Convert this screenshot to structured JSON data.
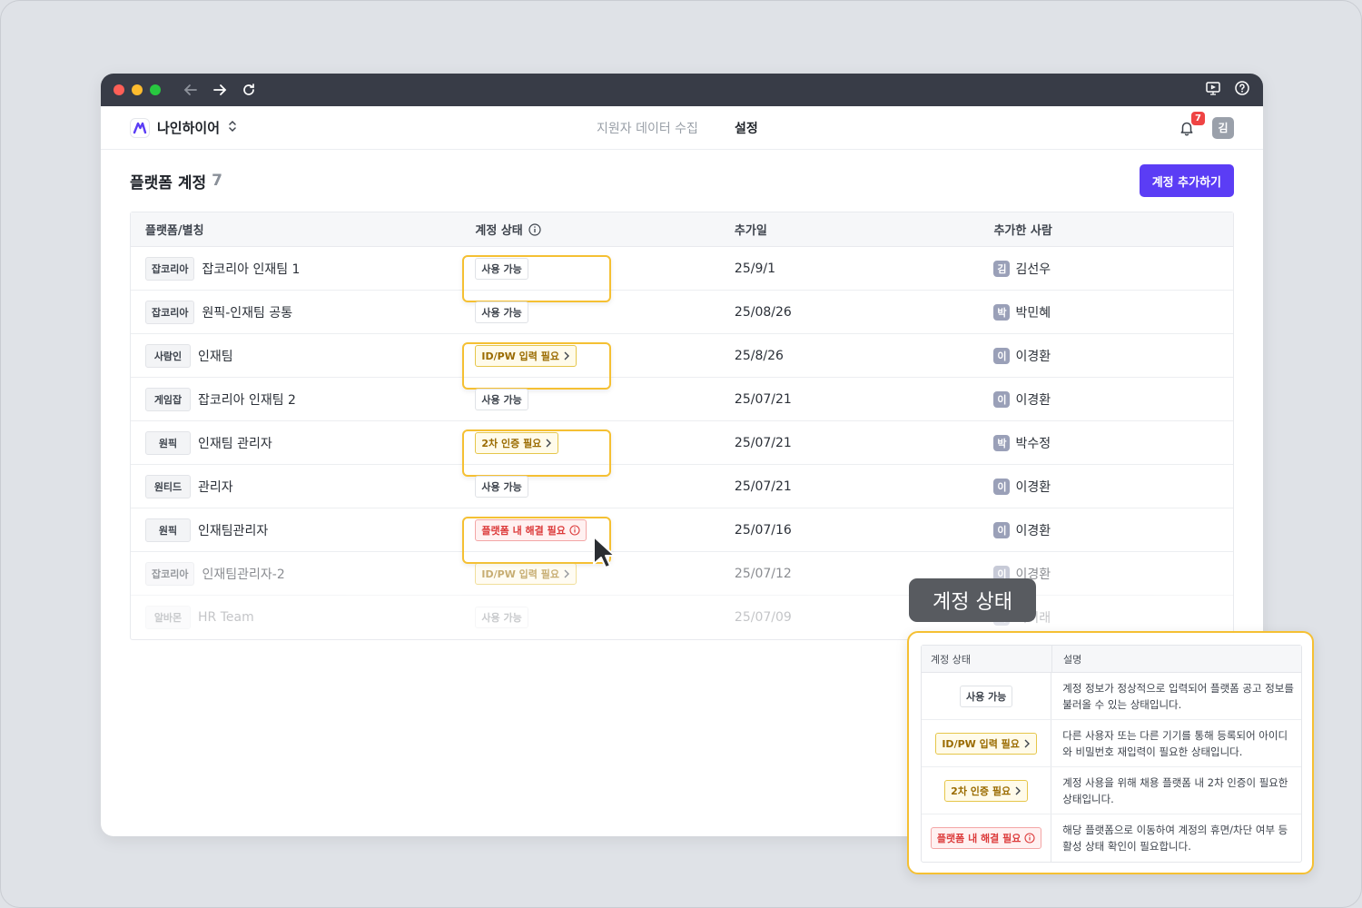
{
  "app": {
    "brand_name": "나인하이어",
    "nav": [
      "지원자 데이터 수집",
      "설정"
    ],
    "notification_count": "7",
    "user_avatar": "김"
  },
  "page": {
    "title": "플랫폼 계정",
    "count": "7",
    "add_button": "계정 추가하기"
  },
  "table": {
    "headers": [
      "플랫폼/별칭",
      "계정 상태",
      "추가일",
      "추가한 사람"
    ],
    "rows": [
      {
        "platform": "잡코리아",
        "alias": "잡코리아 인재팀 1",
        "status": "사용 가능",
        "date": "25/9/1",
        "avatar": "김",
        "person": "김선우"
      },
      {
        "platform": "잡코리아",
        "alias": "원픽-인재팀 공통",
        "status": "사용 가능",
        "date": "25/08/26",
        "avatar": "박",
        "person": "박민혜"
      },
      {
        "platform": "사람인",
        "alias": "인재팀",
        "status": "ID/PW 입력 필요",
        "date": "25/8/26",
        "avatar": "이",
        "person": "이경환"
      },
      {
        "platform": "게임잡",
        "alias": "잡코리아 인재팀 2",
        "status": "사용 가능",
        "date": "25/07/21",
        "avatar": "이",
        "person": "이경환"
      },
      {
        "platform": "원픽",
        "alias": "인재팀 관리자",
        "status": "2차 인증 필요",
        "date": "25/07/21",
        "avatar": "박",
        "person": "박수정"
      },
      {
        "platform": "원티드",
        "alias": "관리자",
        "status": "사용 가능",
        "date": "25/07/21",
        "avatar": "이",
        "person": "이경환"
      },
      {
        "platform": "원픽",
        "alias": "인재팀관리자",
        "status": "플랫폼 내 해결 필요",
        "date": "25/07/16",
        "avatar": "이",
        "person": "이경환"
      },
      {
        "platform": "잡코리아",
        "alias": "인재팀관리자-2",
        "status": "ID/PW 입력 필요",
        "date": "25/07/12",
        "avatar": "이",
        "person": "이경환"
      },
      {
        "platform": "알바몬",
        "alias": "HR Team",
        "status": "사용 가능",
        "date": "25/07/09",
        "avatar": "이",
        "person": "이미래"
      }
    ]
  },
  "tooltip_label": "계정 상태",
  "legend": {
    "headers": [
      "계정 상태",
      "설명"
    ],
    "rows": [
      {
        "status": "사용 가능",
        "desc": "계정 정보가 정상적으로 입력되어 플랫폼 공고 정보를 불러올 수 있는 상태입니다."
      },
      {
        "status": "ID/PW 입력 필요",
        "desc": "다른 사용자 또는 다른 기기를 통해 등록되어 아이디와 비밀번호 재입력이 필요한 상태입니다."
      },
      {
        "status": "2차 인증 필요",
        "desc": "계정 사용을 위해 채용 플랫폼 내 2차 인증이 필요한 상태입니다."
      },
      {
        "status": "플랫폼 내 해결 필요",
        "desc": "해당 플랫폼으로 이동하여 계정의 휴면/차단 여부 등 활성 상태 확인이 필요합니다."
      }
    ]
  },
  "colors": {
    "accent": "#5b3df5",
    "highlight": "#f5c033",
    "warn": "#9a6b00",
    "error": "#dc3b3b",
    "titlebar": "#383c47"
  }
}
